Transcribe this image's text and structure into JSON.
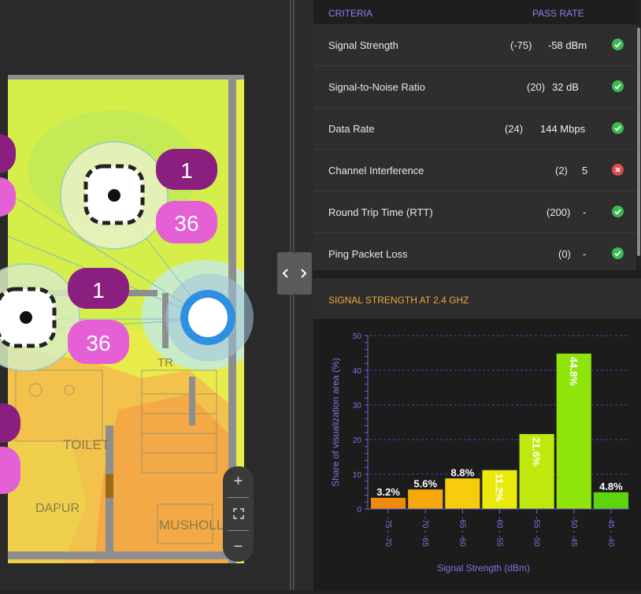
{
  "colors": {
    "accent_purple": "#8f84ea",
    "section_title": "#f3a83c",
    "pass": "#3dba52",
    "fail": "#e54b4b"
  },
  "map": {
    "ap_markers": [
      {
        "channel": "1",
        "band_channel": "36"
      },
      {
        "channel": "1",
        "band_channel": "36"
      }
    ],
    "room_labels": [
      "TR",
      "TOILET",
      "DAPUR",
      "MUSHOLL"
    ],
    "zoom": {
      "in": "+",
      "fit": "fit-icon",
      "out": "−"
    }
  },
  "criteria": {
    "header": {
      "criteria": "CRITERIA",
      "pass_rate": "PASS RATE"
    },
    "rows": [
      {
        "name": "Signal Strength",
        "threshold": "(-75)",
        "value": "-58 dBm",
        "status": "pass"
      },
      {
        "name": "Signal-to-Noise Ratio",
        "threshold": "(20)",
        "value": "32 dB",
        "status": "pass"
      },
      {
        "name": "Data Rate",
        "threshold": "(24)",
        "value": "144 Mbps",
        "status": "pass"
      },
      {
        "name": "Channel Interference",
        "threshold": "(2)",
        "value": "5",
        "status": "fail"
      },
      {
        "name": "Round Trip Time (RTT)",
        "threshold": "(200)",
        "value": "-",
        "status": "pass"
      },
      {
        "name": "Ping Packet Loss",
        "threshold": "(0)",
        "value": "-",
        "status": "pass"
      }
    ]
  },
  "chart_section": {
    "title": "SIGNAL STRENGTH AT 2.4 GHZ"
  },
  "chart_data": {
    "type": "bar",
    "categories": [
      "-75 - -70",
      "-70 - -65",
      "-65 - -60",
      "-60 - -55",
      "-55 - -50",
      "-50 - -45",
      "-45 - -40"
    ],
    "values": [
      3.2,
      5.6,
      8.8,
      11.2,
      21.6,
      44.8,
      4.8
    ],
    "labels": [
      "3.2%",
      "5.6%",
      "8.8%",
      "11.2%",
      "21.6%",
      "44.8%",
      "4.8%"
    ],
    "bar_colors": [
      "#f08a0c",
      "#f5a80c",
      "#f6cc0c",
      "#e9ea0c",
      "#bfe90c",
      "#8fe40c",
      "#5ed40c"
    ],
    "xlabel": "Signal Strength (dBm)",
    "ylabel": "Share of visualization area (%)",
    "ylim": [
      0,
      50
    ],
    "yticks": [
      0,
      10,
      20,
      30,
      40,
      50
    ],
    "grid": true
  }
}
